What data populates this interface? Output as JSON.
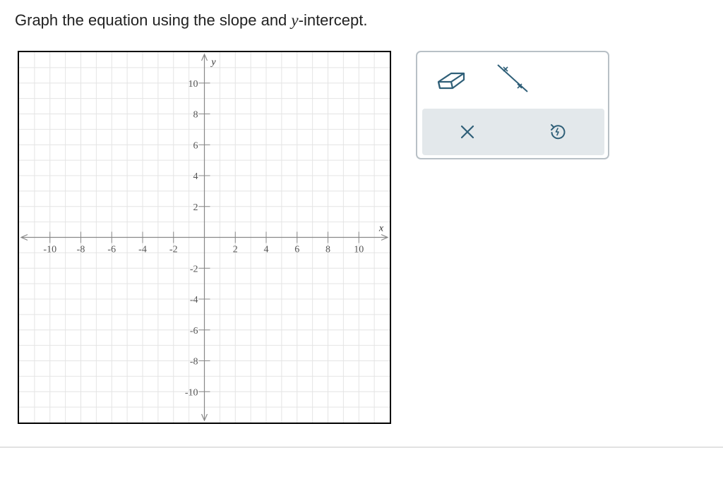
{
  "question": {
    "prompt_before": "Graph the equation using the slope and ",
    "prompt_variable": "y",
    "prompt_after": "-intercept."
  },
  "graph": {
    "x_axis_label": "x",
    "y_axis_label": "y",
    "x_range": [
      -12,
      12
    ],
    "y_range": [
      -12,
      12
    ],
    "grid_step": 1,
    "label_step": 2,
    "x_tick_labels": [
      "-10",
      "-8",
      "-6",
      "-4",
      "-2",
      "2",
      "4",
      "6",
      "8",
      "10"
    ],
    "y_tick_labels": [
      "10",
      "8",
      "6",
      "4",
      "2",
      "-2",
      "-4",
      "-6",
      "-8",
      "-10"
    ],
    "grid_color": "#e4e4e4",
    "axis_color": "#888888"
  },
  "toolbox": {
    "tools": [
      "eraser-icon",
      "line-tool-icon"
    ],
    "actions": [
      "clear-icon",
      "undo-icon"
    ],
    "accent_color": "#2f5f78"
  }
}
